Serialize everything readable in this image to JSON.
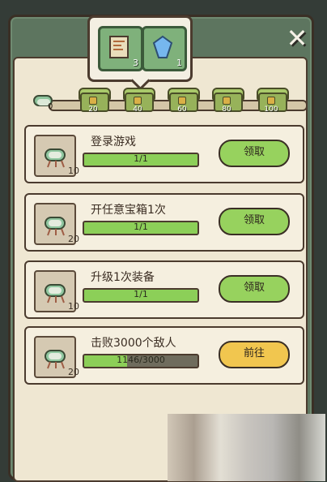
{
  "popup": {
    "items": [
      {
        "icon": "map-scroll-icon",
        "count": "3"
      },
      {
        "icon": "blue-crystal-icon",
        "count": "1"
      }
    ]
  },
  "progress": {
    "current": 0,
    "start_label": "0",
    "milestones": [
      "20",
      "40",
      "60",
      "80",
      "100"
    ]
  },
  "tasks": [
    {
      "title": "登录游戏",
      "progress": "1/1",
      "progress_fraction": 1.0,
      "reward": "10",
      "button": "领取",
      "button_color": "#97d25e"
    },
    {
      "title": "开任意宝箱1次",
      "progress": "1/1",
      "progress_fraction": 1.0,
      "reward": "20",
      "button": "领取",
      "button_color": "#97d25e"
    },
    {
      "title": "升级1次装备",
      "progress": "1/1",
      "progress_fraction": 1.0,
      "reward": "10",
      "button": "领取",
      "button_color": "#97d25e"
    },
    {
      "title": "击败3000个敌人",
      "progress": "1146/3000",
      "progress_fraction": 0.382,
      "reward": "20",
      "button": "前往",
      "button_color": "#f1c64f"
    }
  ]
}
